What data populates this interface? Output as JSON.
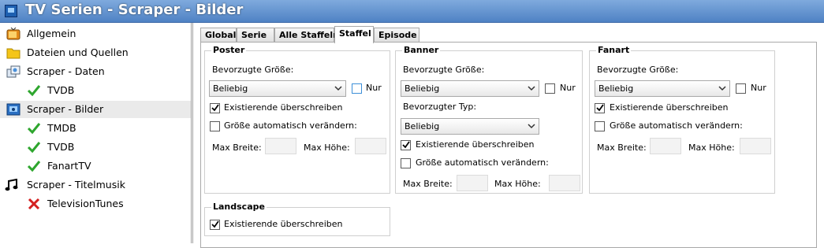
{
  "window": {
    "title": "TV Serien - Scraper - Bilder"
  },
  "sidebar": {
    "items": [
      {
        "label": "Allgemein"
      },
      {
        "label": "Dateien und Quellen"
      },
      {
        "label": "Scraper - Daten"
      },
      {
        "label": "TVDB"
      },
      {
        "label": "Scraper - Bilder"
      },
      {
        "label": "TMDB"
      },
      {
        "label": "TVDB"
      },
      {
        "label": "FanartTV"
      },
      {
        "label": "Scraper - Titelmusik"
      },
      {
        "label": "TelevisionTunes"
      }
    ]
  },
  "tabs": [
    {
      "label": "Global"
    },
    {
      "label": "Serie"
    },
    {
      "label": "Alle Staffeln"
    },
    {
      "label": "Staffel"
    },
    {
      "label": "Episode"
    }
  ],
  "poster": {
    "title": "Poster",
    "size_label": "Bevorzugte Größe:",
    "size_value": "Beliebig",
    "nur_label": "Nur",
    "overwrite_label": "Existierende überschreiben",
    "resize_label": "Größe automatisch verändern:",
    "max_width_label": "Max Breite:",
    "max_height_label": "Max Höhe:"
  },
  "banner": {
    "title": "Banner",
    "size_label": "Bevorzugte Größe:",
    "size_value": "Beliebig",
    "nur_label": "Nur",
    "type_label": "Bevorzugter Typ:",
    "type_value": "Beliebig",
    "overwrite_label": "Existierende überschreiben",
    "resize_label": "Größe automatisch verändern:",
    "max_width_label": "Max Breite:",
    "max_height_label": "Max Höhe:"
  },
  "fanart": {
    "title": "Fanart",
    "size_label": "Bevorzugte Größe:",
    "size_value": "Beliebig",
    "nur_label": "Nur",
    "overwrite_label": "Existierende überschreiben",
    "resize_label": "Größe automatisch verändern:",
    "max_width_label": "Max Breite:",
    "max_height_label": "Max Höhe:"
  },
  "landscape": {
    "title": "Landscape",
    "overwrite_label": "Existierende überschreiben"
  },
  "colors": {
    "titlebar": "#5b8ccc",
    "checkmark_green": "#2ea62e",
    "cross_red": "#d42020"
  }
}
